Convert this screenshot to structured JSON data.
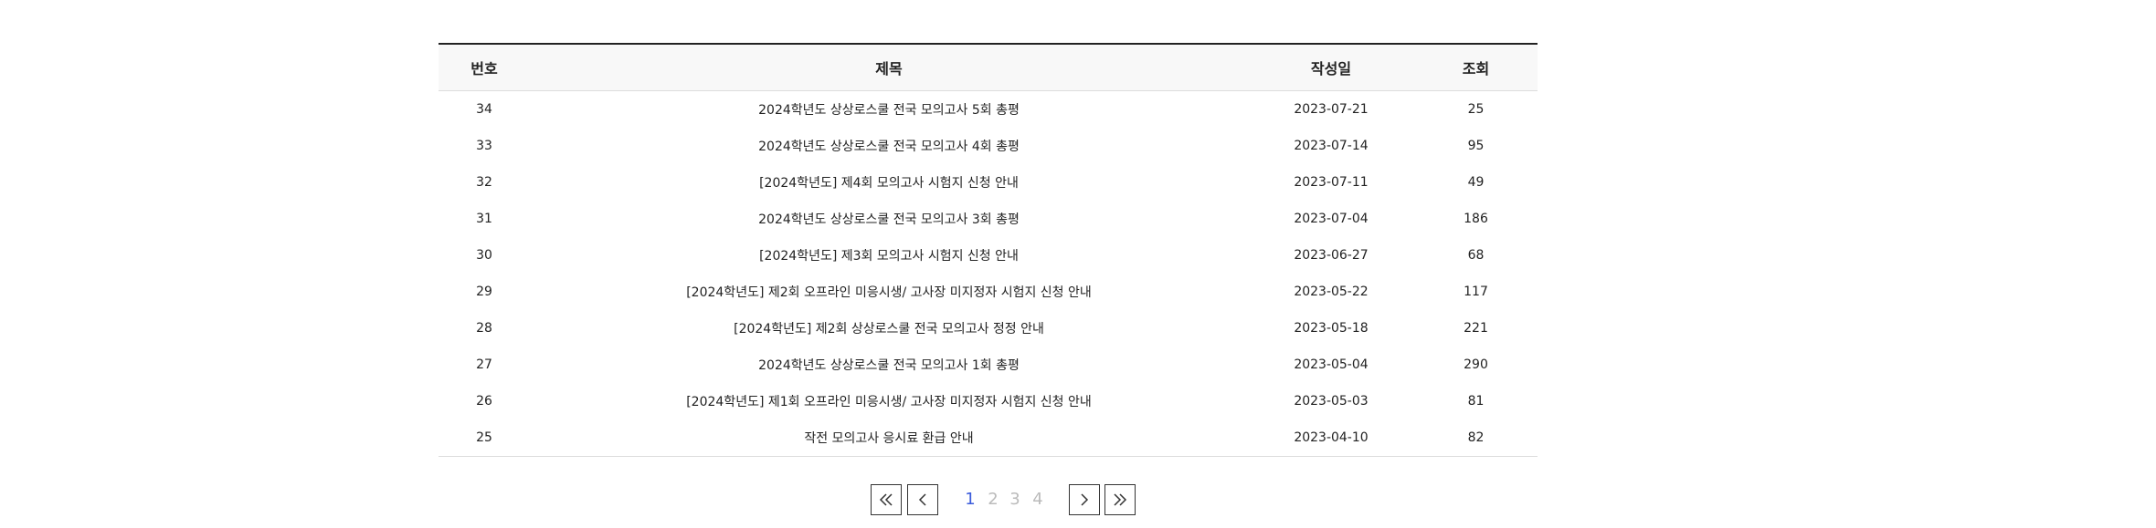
{
  "table": {
    "headers": {
      "no": "번호",
      "title": "제목",
      "date": "작성일",
      "views": "조회"
    },
    "rows": [
      {
        "no": "34",
        "title": "2024학년도 상상로스쿨 전국 모의고사 5회 총평",
        "date": "2023-07-21",
        "views": "25"
      },
      {
        "no": "33",
        "title": "2024학년도 상상로스쿨 전국 모의고사 4회 총평",
        "date": "2023-07-14",
        "views": "95"
      },
      {
        "no": "32",
        "title": "[2024학년도] 제4회 모의고사 시험지 신청 안내",
        "date": "2023-07-11",
        "views": "49"
      },
      {
        "no": "31",
        "title": "2024학년도 상상로스쿨 전국 모의고사 3회 총평",
        "date": "2023-07-04",
        "views": "186"
      },
      {
        "no": "30",
        "title": "[2024학년도] 제3회 모의고사 시험지 신청 안내",
        "date": "2023-06-27",
        "views": "68"
      },
      {
        "no": "29",
        "title": "[2024학년도] 제2회 오프라인 미응시생/ 고사장 미지정자 시험지 신청 안내",
        "date": "2023-05-22",
        "views": "117"
      },
      {
        "no": "28",
        "title": "[2024학년도] 제2회 상상로스쿨 전국 모의고사 정정 안내",
        "date": "2023-05-18",
        "views": "221"
      },
      {
        "no": "27",
        "title": "2024학년도 상상로스쿨 전국 모의고사 1회 총평",
        "date": "2023-05-04",
        "views": "290"
      },
      {
        "no": "26",
        "title": "[2024학년도] 제1회 오프라인 미응시생/ 고사장 미지정자 시험지 신청 안내",
        "date": "2023-05-03",
        "views": "81"
      },
      {
        "no": "25",
        "title": "작전 모의고사 응시료 환급 안내",
        "date": "2023-04-10",
        "views": "82"
      }
    ]
  },
  "pagination": {
    "first_icon": "double-chevron-left-icon",
    "prev_icon": "chevron-left-icon",
    "pages": [
      "1",
      "2",
      "3",
      "4"
    ],
    "current_page": "1",
    "next_icon": "chevron-right-icon",
    "last_icon": "double-chevron-right-icon"
  },
  "colors": {
    "active_page": "#3b5bdb",
    "inactive_page": "#bbbbbb",
    "header_bg": "#f8f8f8",
    "header_border": "#222222"
  }
}
